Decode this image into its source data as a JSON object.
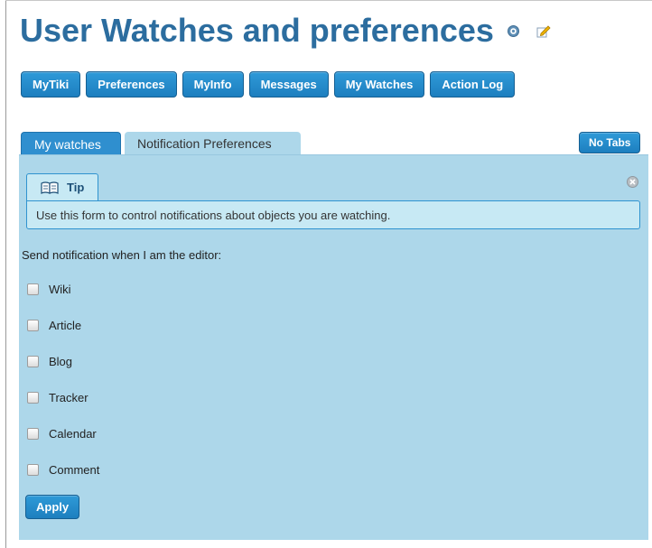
{
  "page": {
    "title": "User Watches and preferences"
  },
  "icons": {
    "help": "help-icon",
    "edit": "edit-icon",
    "tip": "book-icon",
    "close": "close-icon"
  },
  "nav": [
    "MyTiki",
    "Preferences",
    "MyInfo",
    "Messages",
    "My Watches",
    "Action Log"
  ],
  "tabs": {
    "my_watches": "My watches",
    "notification_preferences": "Notification Preferences",
    "no_tabs": "No Tabs"
  },
  "tip": {
    "label": "Tip",
    "text": "Use this form to control notifications about objects you are watching."
  },
  "form": {
    "send_label": "Send notification when I am the editor:",
    "options": [
      {
        "label": "Wiki",
        "checked": false
      },
      {
        "label": "Article",
        "checked": false
      },
      {
        "label": "Blog",
        "checked": false
      },
      {
        "label": "Tracker",
        "checked": false
      },
      {
        "label": "Calendar",
        "checked": false
      },
      {
        "label": "Comment",
        "checked": false
      }
    ],
    "apply_label": "Apply"
  },
  "colors": {
    "title": "#2c6d9f",
    "button": "#1d7fbf",
    "panel": "#add7ea",
    "tip_bg": "#c7e9f4",
    "tip_border": "#2f93cf"
  }
}
